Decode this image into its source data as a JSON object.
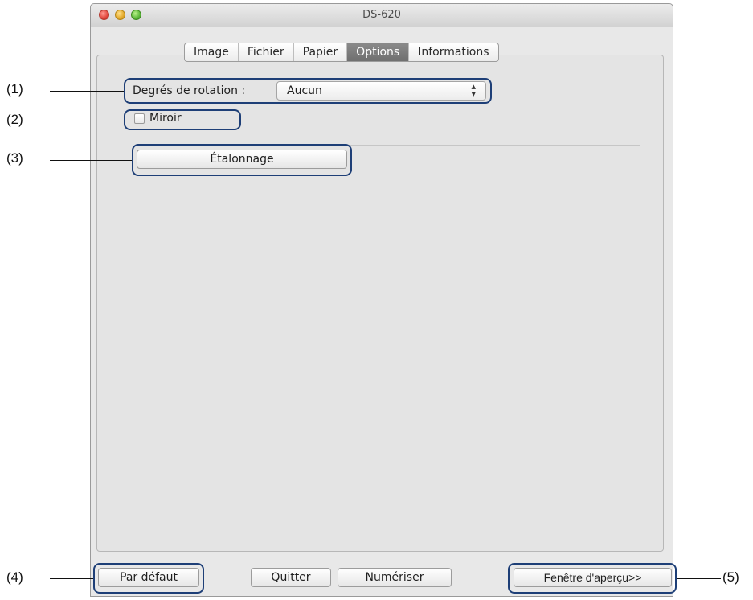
{
  "window": {
    "title": "DS-620"
  },
  "tabs": [
    "Image",
    "Fichier",
    "Papier",
    "Options",
    "Informations"
  ],
  "active_tab": "Options",
  "rotation": {
    "label": "Degrés de rotation :",
    "value": "Aucun"
  },
  "mirror": {
    "label": "Miroir",
    "checked": false
  },
  "calibration_button": "Étalonnage",
  "footer": {
    "default_button": "Par défaut",
    "quit_button": "Quitter",
    "scan_button": "Numériser",
    "preview_button": "Fenêtre d'aperçu>>"
  },
  "callouts": [
    "(1)",
    "(2)",
    "(3)",
    "(4)",
    "(5)"
  ],
  "colors": {
    "callout_border": "#1e3f77",
    "active_tab": "#7a7a7a"
  }
}
